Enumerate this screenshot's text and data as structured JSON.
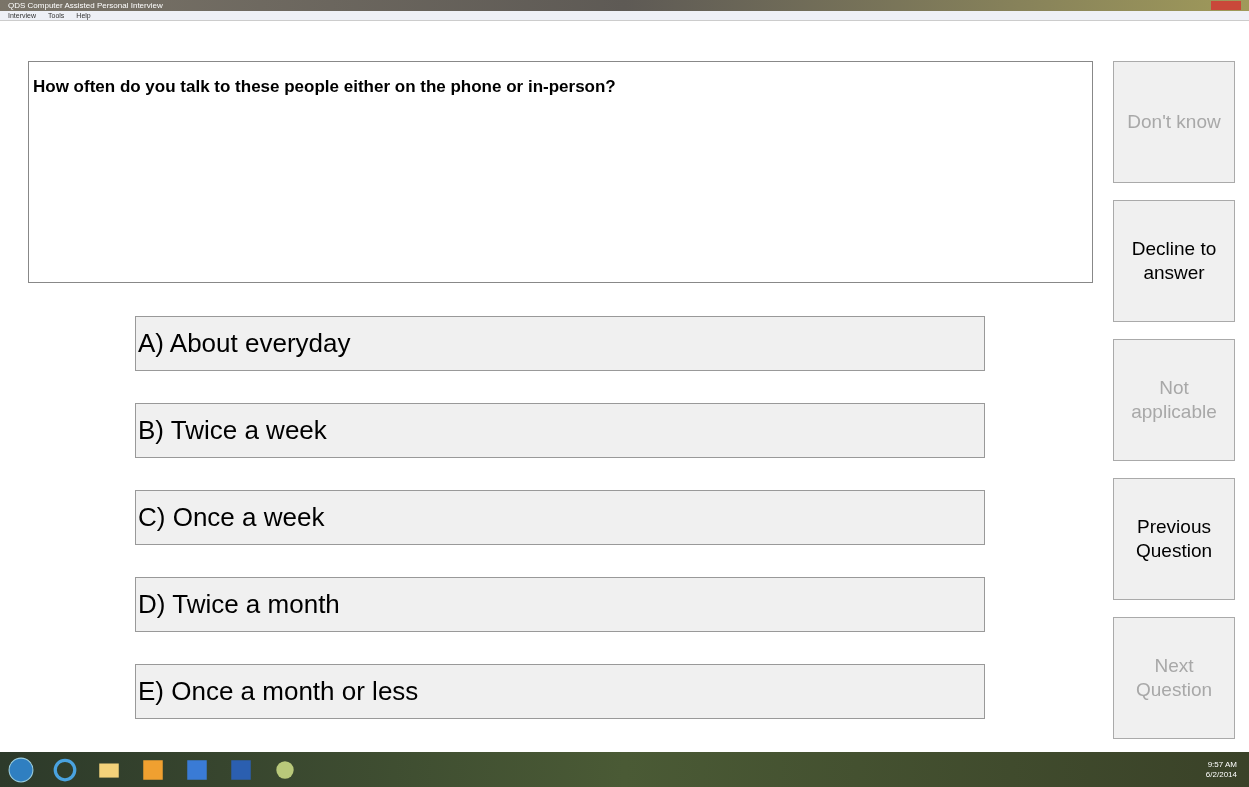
{
  "window": {
    "title": "QDS Computer Assisted Personal Interview"
  },
  "menu": [
    "Interview",
    "Tools",
    "Help"
  ],
  "question": "How often do you talk to these people either on the phone or in-person?",
  "answers": [
    {
      "label": "A) About everyday",
      "selected": false
    },
    {
      "label": "B) Twice a week",
      "selected": false
    },
    {
      "label": "C) Once a week",
      "selected": false
    },
    {
      "label": "D) Twice a month",
      "selected": false
    },
    {
      "label": "E) Once a month or less",
      "selected": false
    }
  ],
  "side_buttons": [
    {
      "label": "Don't know",
      "disabled": true
    },
    {
      "label": "Decline to answer",
      "disabled": false
    },
    {
      "label": "Not applicable",
      "disabled": true
    },
    {
      "label": "Previous Question",
      "disabled": false
    },
    {
      "label": "Next Question",
      "disabled": true
    }
  ],
  "taskbar": {
    "time": "9:57 AM",
    "date": "6/2/2014"
  }
}
